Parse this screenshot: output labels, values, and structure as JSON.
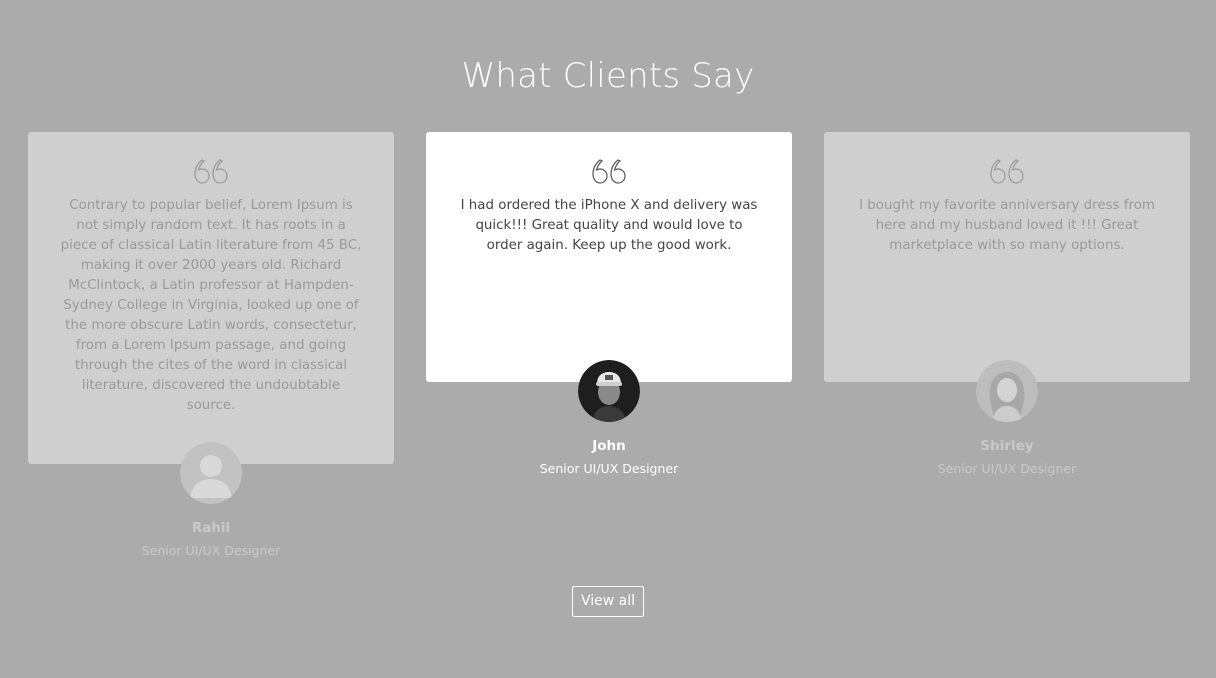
{
  "section": {
    "title": "What Clients Say"
  },
  "testimonials": [
    {
      "quote": "Contrary to popular belief, Lorem Ipsum is not simply random text. It has roots in a piece of classical Latin literature from 45 BC, making it over 2000 years old. Richard McClintock, a Latin professor at Hampden-Sydney College in Virginia, looked up one of the more obscure Latin words, consectetur, from a Lorem Ipsum passage, and going through the cites of the word in classical literature, discovered the undoubtable source.",
      "name": "Rahil",
      "role": "Senior UI/UX Designer",
      "state": "inactive",
      "avatar": "placeholder-person-icon"
    },
    {
      "quote": "I had ordered the iPhone X and delivery was quick!!! Great quality and would love to order again. Keep up the good work.",
      "name": "John",
      "role": "Senior UI/UX Designer",
      "state": "active",
      "avatar": "man-with-cap-photo"
    },
    {
      "quote": "I bought my favorite anniversary dress from here and my husband loved it !!! Great marketplace with so many options.",
      "name": "Shirley",
      "role": "Senior UI/UX Designer",
      "state": "inactive",
      "avatar": "woman-photo"
    }
  ],
  "actions": {
    "view_all_label": "View all"
  },
  "colors": {
    "background": "#ababab",
    "card_active": "#ffffff",
    "card_inactive": "#cfcfcf"
  }
}
